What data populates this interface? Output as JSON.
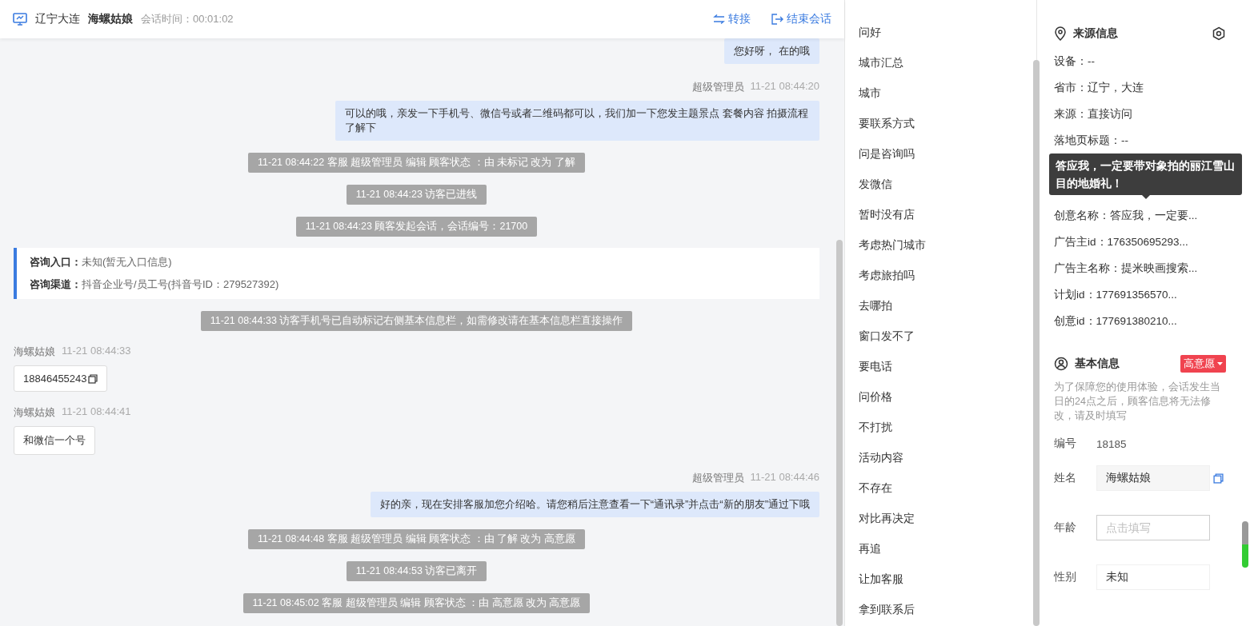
{
  "header": {
    "location": "辽宁大连",
    "visitor": "海螺姑娘",
    "duration_label": "会话时间：",
    "duration": "00:01:02",
    "actions": [
      {
        "label": "转接",
        "kind": "transfer"
      },
      {
        "label": "结束会话",
        "kind": "end"
      }
    ]
  },
  "messages": [
    {
      "kind": "agent",
      "text": "您好呀， 在的哦"
    },
    {
      "kind": "agent",
      "sender": "超级管理员",
      "time": "11-21 08:44:20",
      "text": "可以的哦，亲发一下手机号、微信号或者二维码都可以，我们加一下您发主题景点 套餐内容 拍摄流程了解下"
    },
    {
      "kind": "system",
      "text": "11-21 08:44:22 客服 超级管理员 编辑 顾客状态 ：由 未标记 改为 了解"
    },
    {
      "kind": "system",
      "text": "11-21 08:44:23 访客已进线"
    },
    {
      "kind": "system",
      "text": "11-21 08:44:23 顾客发起会话，会话编号：21700"
    },
    {
      "kind": "entry",
      "lines": [
        {
          "label": "咨询入口：",
          "value": "未知(暂无入口信息)"
        },
        {
          "label": "咨询渠道：",
          "value": "抖音企业号/员工号(抖音号ID：279527392)"
        }
      ]
    },
    {
      "kind": "system",
      "text": "11-21 08:44:33 访客手机号已自动标记右侧基本信息栏，如需修改请在基本信息栏直接操作"
    },
    {
      "kind": "visitor",
      "sender": "海螺姑娘",
      "time": "11-21 08:44:33",
      "text": "18846455243",
      "copyable": true
    },
    {
      "kind": "visitor",
      "sender": "海螺姑娘",
      "time": "11-21 08:44:41",
      "text": "和微信一个号"
    },
    {
      "kind": "agent",
      "sender": "超级管理员",
      "time": "11-21 08:44:46",
      "text": "好的亲，现在安排客服加您介绍哈。请您稍后注意查看一下“通讯录”并点击“新的朋友”通过下哦"
    },
    {
      "kind": "system",
      "text": "11-21 08:44:48 客服 超级管理员 编辑 顾客状态 ：由 了解 改为 高意愿"
    },
    {
      "kind": "system",
      "text": "11-21 08:44:53 访客已离开"
    },
    {
      "kind": "system",
      "text": "11-21 08:45:02 客服 超级管理员 编辑 顾客状态 ：由 高意愿 改为 高意愿"
    }
  ],
  "quick_replies": [
    "问好",
    "城市汇总",
    "城市",
    "要联系方式",
    "问是咨询吗",
    "发微信",
    "暂时没有店",
    "考虑热门城市",
    "考虑旅拍吗",
    "去哪拍",
    "窗口发不了",
    "要电话",
    "问价格",
    "不打扰",
    "活动内容",
    "不存在",
    "对比再决定",
    "再追",
    "让加客服",
    "拿到联系后"
  ],
  "source_info": {
    "title": "来源信息",
    "items": [
      {
        "text": "设备：--"
      },
      {
        "text": "省市：辽宁，大连"
      },
      {
        "text": "来源：直接访问"
      },
      {
        "text": "落地页标题：--"
      },
      {
        "kind": "tooltip",
        "text": "答应我，一定要带对象拍的丽江雪山目的地婚礼！"
      },
      {
        "text": "创意名称：答应我，一定要..."
      },
      {
        "text": "广告主id：176350695293..."
      },
      {
        "text": "广告主名称：提米映画搜索..."
      },
      {
        "text": "计划id：177691356570..."
      },
      {
        "text": "创意id：177691380210..."
      }
    ]
  },
  "basic_info": {
    "title": "基本信息",
    "intent": "高意愿",
    "notice": "为了保障您的使用体验，会话发生当日的24点之后，顾客信息将无法修改，请及时填写",
    "fields": [
      {
        "kind": "text",
        "label": "编号",
        "value": "18185"
      },
      {
        "kind": "input",
        "label": "姓名",
        "value": "海螺姑娘",
        "copyable": true
      },
      {
        "kind": "input",
        "label": "年龄",
        "placeholder": "点击填写"
      },
      {
        "kind": "select",
        "label": "性别",
        "value": "未知"
      }
    ]
  }
}
